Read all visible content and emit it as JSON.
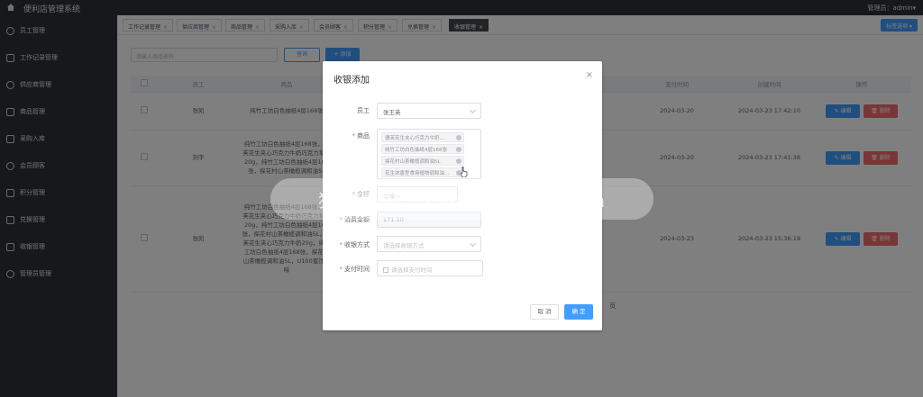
{
  "app": {
    "title": "便利店管理系统",
    "user_label": "管理员：admin▾"
  },
  "sidebar": {
    "items": [
      {
        "label": "员工管理",
        "icon": "person-icon"
      },
      {
        "label": "工作记录管理",
        "icon": "document-icon"
      },
      {
        "label": "供应商管理",
        "icon": "person-icon"
      },
      {
        "label": "商品管理",
        "icon": "box-icon"
      },
      {
        "label": "采购入库",
        "icon": "document-icon"
      },
      {
        "label": "会员顾客",
        "icon": "person-icon"
      },
      {
        "label": "积分管理",
        "icon": "gift-icon"
      },
      {
        "label": "兑换管理",
        "icon": "exchange-icon"
      },
      {
        "label": "收银管理",
        "icon": "document-icon"
      },
      {
        "label": "管理员管理",
        "icon": "person-icon"
      }
    ]
  },
  "tabs": {
    "items": [
      "工作记录管理",
      "供应商管理",
      "商品管理",
      "采购入库",
      "会员顾客",
      "积分管理",
      "兑换管理",
      "收银管理"
    ],
    "close_glyph": "×",
    "dropdown_label": "标签选项 ▾"
  },
  "toolbar": {
    "search_placeholder": "请输入商品名称",
    "search_label": "查询",
    "add_label": "+ 添加"
  },
  "table": {
    "headers": [
      "",
      "员工",
      "商品",
      "",
      "",
      "",
      "",
      "支付时间",
      "创建时间",
      "操作"
    ],
    "rows": [
      {
        "employee": "张凯",
        "goods": "纯竹工坊白色抽纸4层168张",
        "pay_time": "2024-03-20",
        "create_time": "2024-03-23 17:42:10"
      },
      {
        "employee": "刘宇",
        "goods": "纯竹工坊白色抽纸4层168张，德芙花生夹心巧克力牛奶巧克力草莓20g，纯竹工坊白色抽纸4层168张，探花村山茶橄榄调和油5L",
        "pay_time": "2024-03-20",
        "create_time": "2024-03-23 17:41:38"
      },
      {
        "employee": "张凯",
        "goods": "纯竹工坊白色抽纸4层168张，德芙花生夹心巧克力牛奶巧克力草莓20g，纯竹工坊白色抽纸4层168张，探花村山茶橄榄调和油5L，德芙花生夹心巧克力牛奶20g，纯竹工坊白色抽纸4层168张，探花村山茶橄榄调和油5L，U100蜜饯原味",
        "pay_time": "2024-03-23",
        "create_time": "2024-03-23 15:36:19"
      }
    ],
    "edit_label": "✎ 编辑",
    "delete_label": "🗑 删除",
    "total_suffix": "页"
  },
  "watermark": {
    "banner": "猫头鹰源码 maotouyingcc.com"
  },
  "dialog": {
    "title": "收银添加",
    "close_glyph": "×",
    "employee_label": "员工",
    "employee_value": "张王英",
    "goods_label": "商品",
    "goods_tags": [
      "德芙花生夹心巧克力牛奶...",
      "纯竹工坊白色抽纸4层168张",
      "探花村山茶橄榄调和油5L",
      "花生浓香型食用植物调和油..."
    ],
    "points_label": "金额",
    "points_placeholder": "请输入",
    "amount_label": "消费金额",
    "amount_value": "171.10",
    "pay_method_label": "收银方式",
    "pay_method_placeholder": "请选择收银方式",
    "pay_time_label": "支付时间",
    "pay_time_placeholder": "请选择支付时间",
    "cancel_label": "取 消",
    "ok_label": "确 定"
  }
}
